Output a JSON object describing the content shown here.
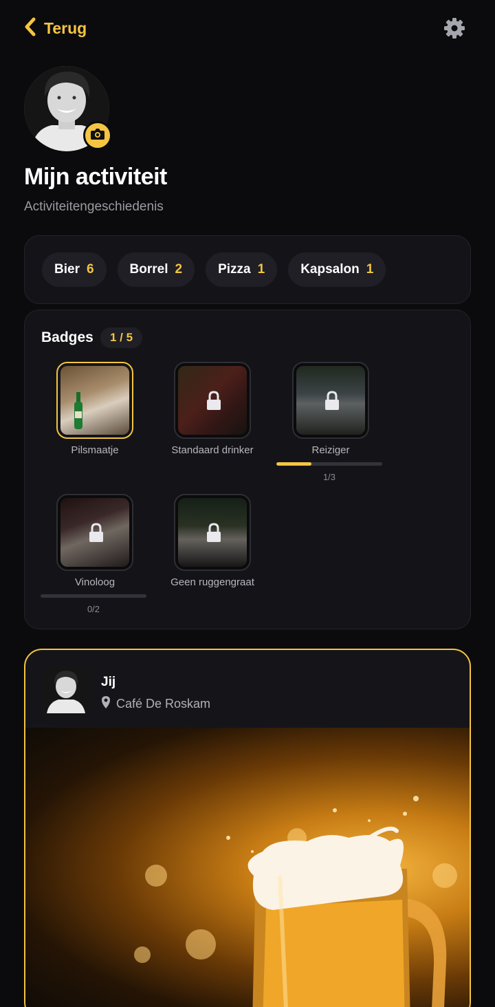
{
  "header": {
    "back_label": "Terug",
    "back_icon": "chevron-left-icon",
    "settings_icon": "gear-icon"
  },
  "profile": {
    "avatar_icon": "camera-icon",
    "title": "Mijn activiteit",
    "subtitle": "Activiteitengeschiedenis"
  },
  "stats": [
    {
      "label": "Bier",
      "count": "6"
    },
    {
      "label": "Borrel",
      "count": "2"
    },
    {
      "label": "Pizza",
      "count": "1"
    },
    {
      "label": "Kapsalon",
      "count": "1"
    }
  ],
  "badges": {
    "title": "Badges",
    "count": "1 / 5",
    "items": [
      {
        "name": "Pilsmaatje",
        "locked": false
      },
      {
        "name": "Standaard drinker",
        "locked": true
      },
      {
        "name": "Reiziger",
        "locked": true,
        "progress_label": "1/3",
        "progress": 0.33
      },
      {
        "name": "Vinoloog",
        "locked": true,
        "progress_label": "0/2",
        "progress": 0
      },
      {
        "name": "Geen ruggengraat",
        "locked": true
      }
    ]
  },
  "post": {
    "author": "Jij",
    "location": "Café De Roskam",
    "location_icon": "map-pin-icon"
  },
  "colors": {
    "accent": "#f4c542",
    "background": "#0b0b0d",
    "card": "#141418"
  }
}
